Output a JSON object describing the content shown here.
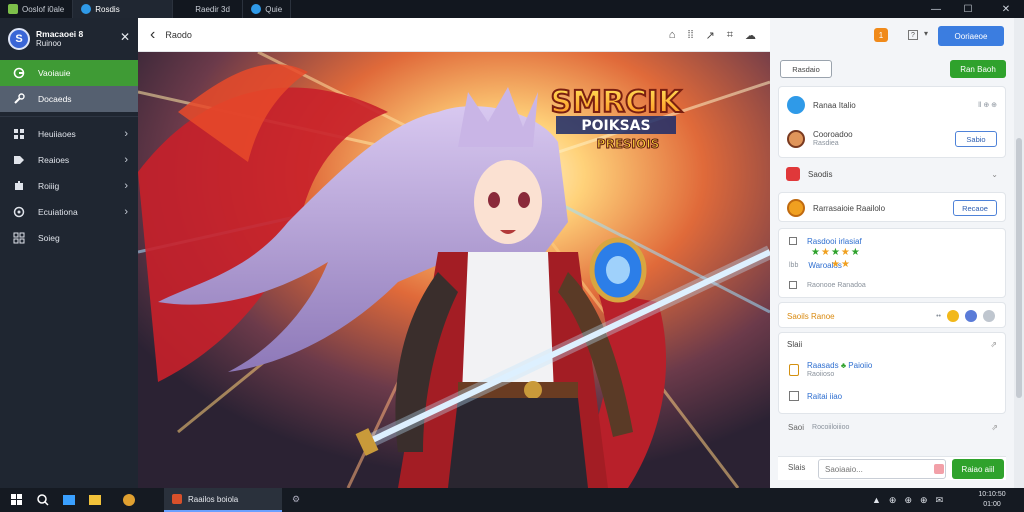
{
  "titlebar": {
    "tabs": [
      {
        "label": "Ooslof i0ale",
        "icon": "app-icon"
      },
      {
        "label": "Rosdis",
        "icon": "blue-globe-icon"
      },
      {
        "label": "Raedir 3d",
        "icon": "page-icon"
      },
      {
        "label": "Quie",
        "icon": "blue-globe-icon"
      }
    ],
    "controls": {
      "minimize": "—",
      "maximize": "☐",
      "close": "✕"
    }
  },
  "sidebar": {
    "profile": {
      "name": "Rmacaoei 8",
      "subtitle": "Ruinoo"
    },
    "close_icon": "✕",
    "items": [
      {
        "label": "Vaoiauie",
        "icon": "home-icon",
        "selected": true
      },
      {
        "label": "Docaeds",
        "icon": "wrench-icon",
        "highlight": true
      },
      {
        "label": "Heuiiaoes",
        "icon": "grid-icon",
        "chevron": true
      },
      {
        "label": "Reaioes",
        "icon": "tag-icon",
        "chevron": true
      },
      {
        "label": "Roiiig",
        "icon": "puzzle-icon",
        "chevron": true
      },
      {
        "label": "Ecuiationa",
        "icon": "compass-icon",
        "chevron": true
      },
      {
        "label": "Soieg",
        "icon": "apps-icon",
        "chevron": false
      }
    ]
  },
  "viewer": {
    "title": "Raodo",
    "back_icon": "‹",
    "tools": [
      "home-icon",
      "split-icon",
      "share-icon",
      "gallery-icon",
      "cloud-icon"
    ],
    "artwork": {
      "logo_line1": "SMRCIK",
      "logo_line2": "POIKSAS",
      "logo_line3": "PRESIOIS"
    }
  },
  "rpanel": {
    "header": {
      "notif_badge": "1",
      "help_icon": "?",
      "menu_icon": "▾",
      "primary_button": "Ooriaeoe"
    },
    "toolbar": {
      "left_button": "Rasdaio",
      "right_button": "Ran Baoh"
    },
    "card1": {
      "item1": {
        "title": "Ranaa Italio",
        "meta": "ll ⊕ ⊕"
      },
      "item2": {
        "title": "Cooroadoo",
        "sub": "Rasdiea",
        "button": "Sabio"
      }
    },
    "section": {
      "label": "Saodis",
      "chevron": "⌄"
    },
    "card2": {
      "title": "Rarrasaioie Raailolo",
      "button": "Recaoe"
    },
    "card3": {
      "row1_label": "Rasdooi irlasiaf",
      "row2_label": "Waroalos",
      "row3_label": "Raonooe Ranadoa",
      "stars_row1": 5,
      "stars_row2": 2
    },
    "card4": {
      "label": "Saoils Ranoe"
    },
    "card5": {
      "label1": "Slaii",
      "label2": "Raasads",
      "label2b": "Paioiio",
      "sub": "Raoiioso",
      "label3": "Raitai iiao"
    },
    "footer_row": {
      "label1": "Saoi",
      "label2": "Rocoiiloiiioo"
    },
    "compose": {
      "label": "Slais",
      "placeholder": "Saoiaaio...",
      "send_button": "Raiao aiil"
    }
  },
  "taskbar": {
    "app_label": "Raailos boiola",
    "tray": [
      "▲",
      "⊕",
      "⊕",
      "⊕",
      "✉"
    ],
    "clock_top": "10:10:50",
    "clock_bottom": "01:00"
  },
  "colors": {
    "sidebar_bg": "#1f2631",
    "selected_green": "#3f9b35",
    "accent_blue": "#3b7de0",
    "accent_green": "#2fa22c"
  }
}
